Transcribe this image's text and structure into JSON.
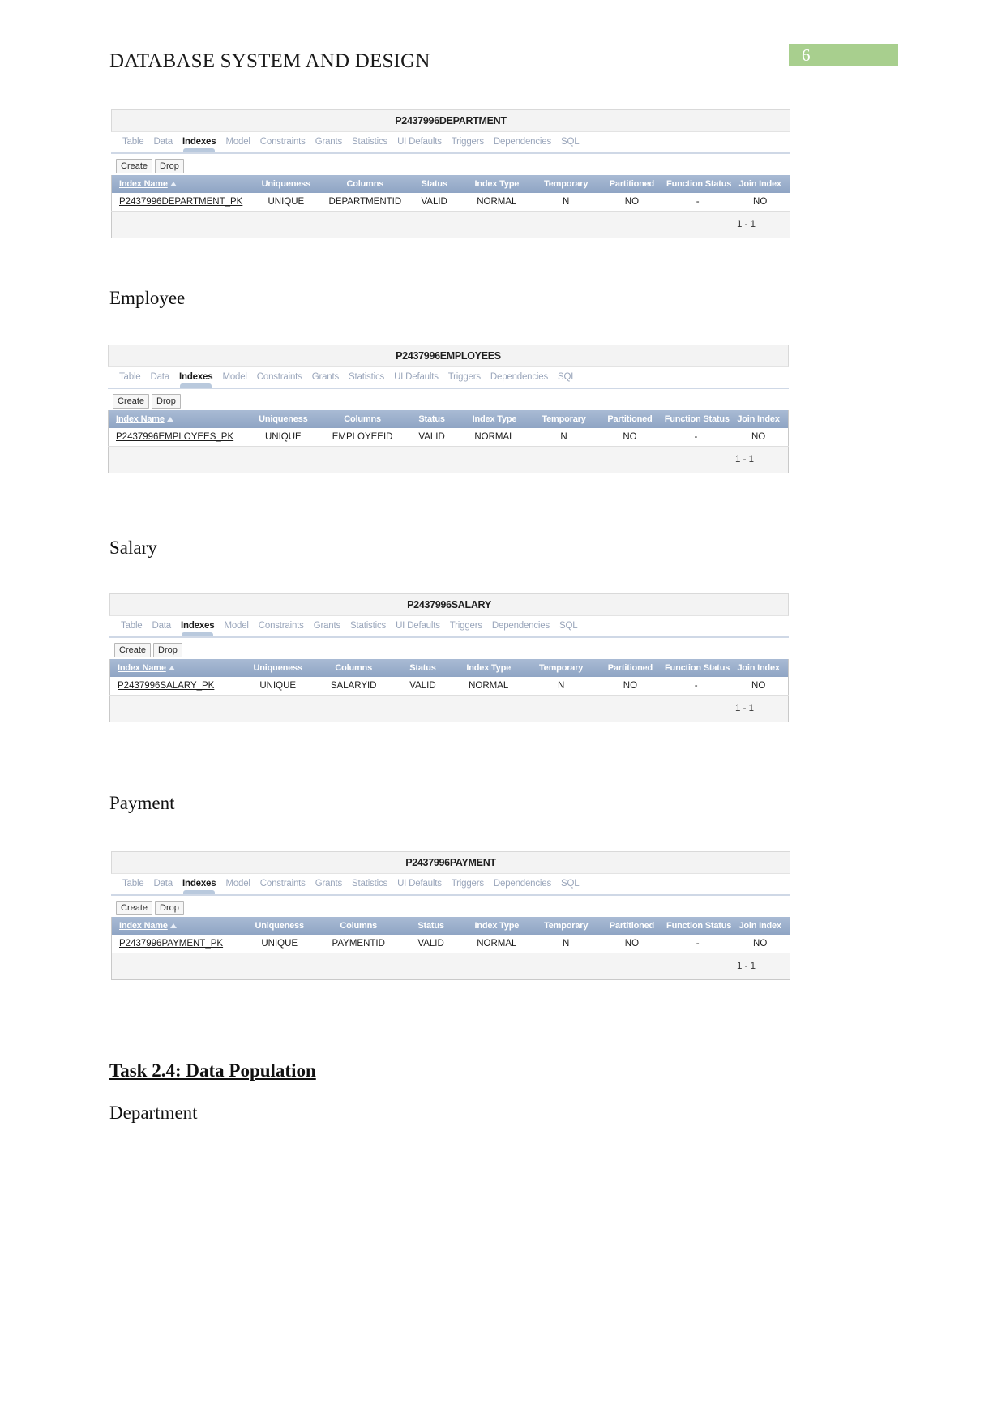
{
  "document": {
    "title": "DATABASE SYSTEM AND DESIGN",
    "page_number": "6",
    "page_badge_color": "#a8cf8e"
  },
  "sections": [
    {
      "label": "Employee"
    },
    {
      "label": "Salary"
    },
    {
      "label": "Payment"
    },
    {
      "label": "Department"
    }
  ],
  "task_heading": "Task 2.4: Data Population ",
  "tabs": [
    "Table",
    "Data",
    "Indexes",
    "Model",
    "Constraints",
    "Grants",
    "Statistics",
    "UI Defaults",
    "Triggers",
    "Dependencies",
    "SQL"
  ],
  "active_tab": "Indexes",
  "toolbar": {
    "create_label": "Create",
    "drop_label": "Drop"
  },
  "table_columns": [
    "Index Name",
    "Uniqueness",
    "Columns",
    "Status",
    "Index Type",
    "Temporary",
    "Partitioned",
    "Function Status",
    "Join Index"
  ],
  "pager_text": "1 - 1",
  "screenshots": [
    {
      "title": "P2437996DEPARTMENT",
      "row": {
        "index_name": "P2437996DEPARTMENT_PK",
        "uniqueness": "UNIQUE",
        "columns": "DEPARTMENTID",
        "status": "VALID",
        "index_type": "NORMAL",
        "temporary": "N",
        "partitioned": "NO",
        "function_status": "-",
        "join_index": "NO"
      }
    },
    {
      "title": "P2437996EMPLOYEES",
      "row": {
        "index_name": "P2437996EMPLOYEES_PK",
        "uniqueness": "UNIQUE",
        "columns": "EMPLOYEEID",
        "status": "VALID",
        "index_type": "NORMAL",
        "temporary": "N",
        "partitioned": "NO",
        "function_status": "-",
        "join_index": "NO"
      }
    },
    {
      "title": "P2437996SALARY",
      "row": {
        "index_name": "P2437996SALARY_PK",
        "uniqueness": "UNIQUE",
        "columns": "SALARYID",
        "status": "VALID",
        "index_type": "NORMAL",
        "temporary": "N",
        "partitioned": "NO",
        "function_status": "-",
        "join_index": "NO"
      }
    },
    {
      "title": "P2437996PAYMENT",
      "row": {
        "index_name": "P2437996PAYMENT_PK",
        "uniqueness": "UNIQUE",
        "columns": "PAYMENTID",
        "status": "VALID",
        "index_type": "NORMAL",
        "temporary": "N",
        "partitioned": "NO",
        "function_status": "-",
        "join_index": "NO"
      }
    }
  ]
}
